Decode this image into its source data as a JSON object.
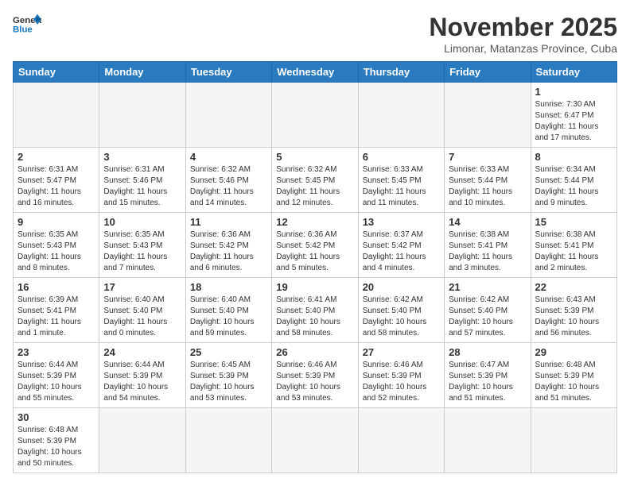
{
  "header": {
    "logo_general": "General",
    "logo_blue": "Blue",
    "month_title": "November 2025",
    "location": "Limonar, Matanzas Province, Cuba"
  },
  "weekdays": [
    "Sunday",
    "Monday",
    "Tuesday",
    "Wednesday",
    "Thursday",
    "Friday",
    "Saturday"
  ],
  "weeks": [
    [
      {
        "day": "",
        "info": ""
      },
      {
        "day": "",
        "info": ""
      },
      {
        "day": "",
        "info": ""
      },
      {
        "day": "",
        "info": ""
      },
      {
        "day": "",
        "info": ""
      },
      {
        "day": "",
        "info": ""
      },
      {
        "day": "1",
        "info": "Sunrise: 7:30 AM\nSunset: 6:47 PM\nDaylight: 11 hours\nand 17 minutes."
      }
    ],
    [
      {
        "day": "2",
        "info": "Sunrise: 6:31 AM\nSunset: 5:47 PM\nDaylight: 11 hours\nand 16 minutes."
      },
      {
        "day": "3",
        "info": "Sunrise: 6:31 AM\nSunset: 5:46 PM\nDaylight: 11 hours\nand 15 minutes."
      },
      {
        "day": "4",
        "info": "Sunrise: 6:32 AM\nSunset: 5:46 PM\nDaylight: 11 hours\nand 14 minutes."
      },
      {
        "day": "5",
        "info": "Sunrise: 6:32 AM\nSunset: 5:45 PM\nDaylight: 11 hours\nand 12 minutes."
      },
      {
        "day": "6",
        "info": "Sunrise: 6:33 AM\nSunset: 5:45 PM\nDaylight: 11 hours\nand 11 minutes."
      },
      {
        "day": "7",
        "info": "Sunrise: 6:33 AM\nSunset: 5:44 PM\nDaylight: 11 hours\nand 10 minutes."
      },
      {
        "day": "8",
        "info": "Sunrise: 6:34 AM\nSunset: 5:44 PM\nDaylight: 11 hours\nand 9 minutes."
      }
    ],
    [
      {
        "day": "9",
        "info": "Sunrise: 6:35 AM\nSunset: 5:43 PM\nDaylight: 11 hours\nand 8 minutes."
      },
      {
        "day": "10",
        "info": "Sunrise: 6:35 AM\nSunset: 5:43 PM\nDaylight: 11 hours\nand 7 minutes."
      },
      {
        "day": "11",
        "info": "Sunrise: 6:36 AM\nSunset: 5:42 PM\nDaylight: 11 hours\nand 6 minutes."
      },
      {
        "day": "12",
        "info": "Sunrise: 6:36 AM\nSunset: 5:42 PM\nDaylight: 11 hours\nand 5 minutes."
      },
      {
        "day": "13",
        "info": "Sunrise: 6:37 AM\nSunset: 5:42 PM\nDaylight: 11 hours\nand 4 minutes."
      },
      {
        "day": "14",
        "info": "Sunrise: 6:38 AM\nSunset: 5:41 PM\nDaylight: 11 hours\nand 3 minutes."
      },
      {
        "day": "15",
        "info": "Sunrise: 6:38 AM\nSunset: 5:41 PM\nDaylight: 11 hours\nand 2 minutes."
      }
    ],
    [
      {
        "day": "16",
        "info": "Sunrise: 6:39 AM\nSunset: 5:41 PM\nDaylight: 11 hours\nand 1 minute."
      },
      {
        "day": "17",
        "info": "Sunrise: 6:40 AM\nSunset: 5:40 PM\nDaylight: 11 hours\nand 0 minutes."
      },
      {
        "day": "18",
        "info": "Sunrise: 6:40 AM\nSunset: 5:40 PM\nDaylight: 10 hours\nand 59 minutes."
      },
      {
        "day": "19",
        "info": "Sunrise: 6:41 AM\nSunset: 5:40 PM\nDaylight: 10 hours\nand 58 minutes."
      },
      {
        "day": "20",
        "info": "Sunrise: 6:42 AM\nSunset: 5:40 PM\nDaylight: 10 hours\nand 58 minutes."
      },
      {
        "day": "21",
        "info": "Sunrise: 6:42 AM\nSunset: 5:40 PM\nDaylight: 10 hours\nand 57 minutes."
      },
      {
        "day": "22",
        "info": "Sunrise: 6:43 AM\nSunset: 5:39 PM\nDaylight: 10 hours\nand 56 minutes."
      }
    ],
    [
      {
        "day": "23",
        "info": "Sunrise: 6:44 AM\nSunset: 5:39 PM\nDaylight: 10 hours\nand 55 minutes."
      },
      {
        "day": "24",
        "info": "Sunrise: 6:44 AM\nSunset: 5:39 PM\nDaylight: 10 hours\nand 54 minutes."
      },
      {
        "day": "25",
        "info": "Sunrise: 6:45 AM\nSunset: 5:39 PM\nDaylight: 10 hours\nand 53 minutes."
      },
      {
        "day": "26",
        "info": "Sunrise: 6:46 AM\nSunset: 5:39 PM\nDaylight: 10 hours\nand 53 minutes."
      },
      {
        "day": "27",
        "info": "Sunrise: 6:46 AM\nSunset: 5:39 PM\nDaylight: 10 hours\nand 52 minutes."
      },
      {
        "day": "28",
        "info": "Sunrise: 6:47 AM\nSunset: 5:39 PM\nDaylight: 10 hours\nand 51 minutes."
      },
      {
        "day": "29",
        "info": "Sunrise: 6:48 AM\nSunset: 5:39 PM\nDaylight: 10 hours\nand 51 minutes."
      }
    ],
    [
      {
        "day": "30",
        "info": "Sunrise: 6:48 AM\nSunset: 5:39 PM\nDaylight: 10 hours\nand 50 minutes."
      },
      {
        "day": "",
        "info": ""
      },
      {
        "day": "",
        "info": ""
      },
      {
        "day": "",
        "info": ""
      },
      {
        "day": "",
        "info": ""
      },
      {
        "day": "",
        "info": ""
      },
      {
        "day": "",
        "info": ""
      }
    ]
  ]
}
